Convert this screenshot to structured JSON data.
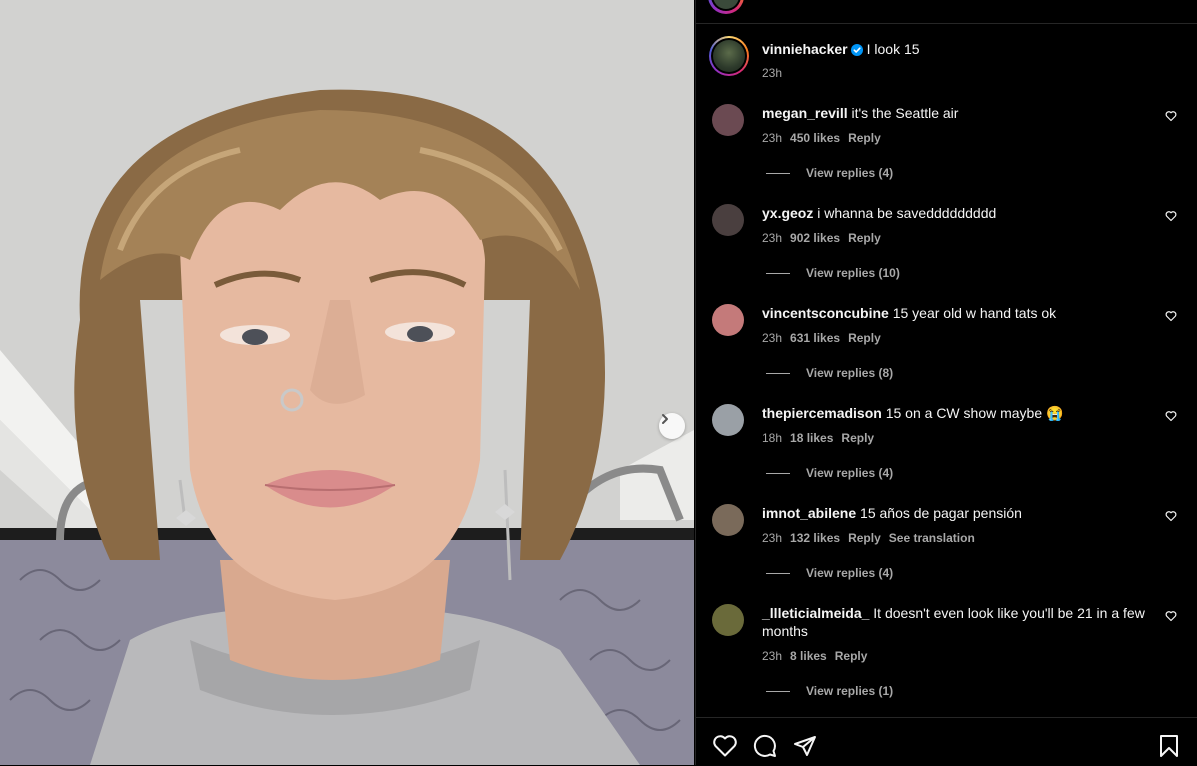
{
  "post": {
    "username": "vinniehacker",
    "caption": "I look 15",
    "time": "23h"
  },
  "comments": [
    {
      "username": "megan_revill",
      "text": "it's the Seattle air",
      "time": "23h",
      "likes": "450 likes",
      "reply": "Reply",
      "replies": "View replies (4)",
      "avatar_color": "#6b4a52"
    },
    {
      "username": "yx.geoz",
      "text": "i whanna be saveddddddddd",
      "time": "23h",
      "likes": "902 likes",
      "reply": "Reply",
      "replies": "View replies (10)",
      "avatar_color": "#4a3f3f"
    },
    {
      "username": "vincentsconcubine",
      "text": "15 year old w hand tats ok",
      "time": "23h",
      "likes": "631 likes",
      "reply": "Reply",
      "replies": "View replies (8)",
      "avatar_color": "#c47a7a"
    },
    {
      "username": "thepiercemadison",
      "text": "15 on a CW show maybe 😭",
      "time": "18h",
      "likes": "18 likes",
      "reply": "Reply",
      "replies": "View replies (4)",
      "avatar_color": "#9aa0a6"
    },
    {
      "username": "imnot_abilene",
      "text": "15 años de pagar pensión",
      "time": "23h",
      "likes": "132 likes",
      "reply": "Reply",
      "translate": "See translation",
      "replies": "View replies (4)",
      "avatar_color": "#7a6a5a"
    },
    {
      "username": "_llleticialmeida_",
      "text": "It doesn't even look like you'll be 21 in a few months",
      "time": "23h",
      "likes": "8 likes",
      "reply": "Reply",
      "replies": "View replies (1)",
      "avatar_color": "#6a6a3a"
    }
  ],
  "icons": {
    "like": "heart-icon",
    "comment": "comment-icon",
    "share": "share-icon",
    "save": "bookmark-icon",
    "next": "chevron-right-icon",
    "verified": "verified-badge-icon"
  },
  "colors": {
    "background": "#000000",
    "text": "#f5f5f5",
    "secondary_text": "#a8a8a8",
    "verified": "#0095f6"
  }
}
